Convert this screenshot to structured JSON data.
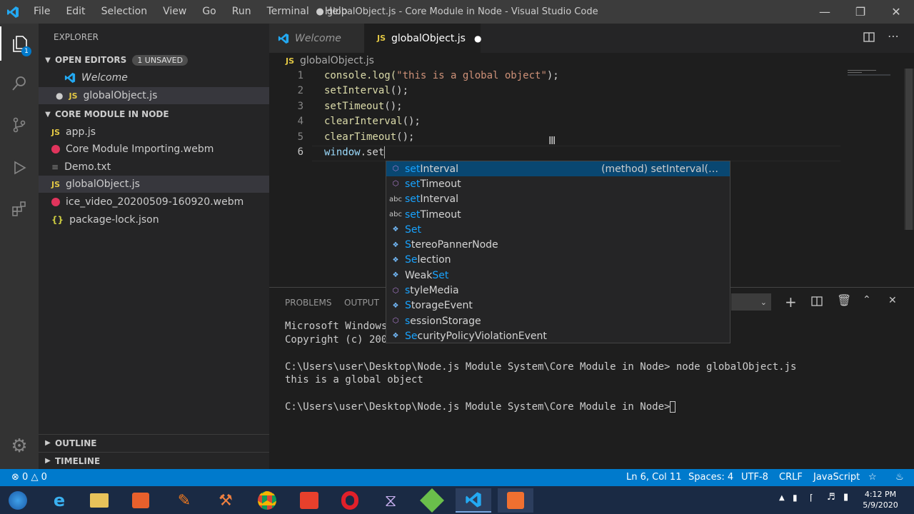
{
  "titlebar": {
    "menu": [
      "File",
      "Edit",
      "Selection",
      "View",
      "Go",
      "Run",
      "Terminal",
      "Help"
    ],
    "title": "● globalObject.js - Core Module in Node - Visual Studio Code"
  },
  "activity": {
    "explorer_badge": "1"
  },
  "sidebar": {
    "header": "EXPLORER",
    "open_editors": {
      "title": "OPEN EDITORS",
      "badge": "1 UNSAVED",
      "items": [
        {
          "label": "Welcome"
        },
        {
          "label": "globalObject.js",
          "icon": "JS"
        }
      ]
    },
    "folder": {
      "title": "CORE MODULE IN NODE",
      "items": [
        {
          "label": "app.js",
          "icon": "JS"
        },
        {
          "label": "Core Module Importing.webm"
        },
        {
          "label": "Demo.txt"
        },
        {
          "label": "globalObject.js",
          "icon": "JS"
        },
        {
          "label": "ice_video_20200509-160920.webm"
        },
        {
          "label": "package-lock.json",
          "icon": "{}"
        }
      ]
    },
    "outline": "OUTLINE",
    "timeline": "TIMELINE"
  },
  "tabs": [
    {
      "label": "Welcome"
    },
    {
      "label": "globalObject.js",
      "icon": "JS"
    }
  ],
  "breadcrumb": {
    "icon": "JS",
    "file": "globalObject.js"
  },
  "editor": {
    "line_numbers": [
      "1",
      "2",
      "3",
      "4",
      "5",
      "6"
    ],
    "lines": [
      {
        "fn": "console.log(",
        "str": "\"this is a global object\"",
        "rest": ");"
      },
      {
        "fn": "setInterval",
        "rest": "();"
      },
      {
        "fn": "setTimeout",
        "rest": "();"
      },
      {
        "fn": "clearInterval",
        "rest": "();"
      },
      {
        "fn": "clearTimeout",
        "rest": "();"
      },
      {
        "var": "window",
        "rest": ".set"
      }
    ]
  },
  "suggest": {
    "detail": "(method) setInterval(…",
    "items": [
      {
        "icon": "method",
        "pre": "",
        "match": "set",
        "post": "Interval"
      },
      {
        "icon": "method",
        "pre": "",
        "match": "set",
        "post": "Timeout"
      },
      {
        "icon": "abc",
        "pre": "",
        "match": "set",
        "post": "Interval"
      },
      {
        "icon": "abc",
        "pre": "",
        "match": "set",
        "post": "Timeout"
      },
      {
        "icon": "field",
        "pre": "",
        "match": "Set",
        "post": ""
      },
      {
        "icon": "field",
        "pre": "",
        "match": "S",
        "post": "tereoPannerNode"
      },
      {
        "icon": "field",
        "pre": "",
        "match": "Se",
        "post": "lection"
      },
      {
        "icon": "field",
        "pre": "Weak",
        "match": "Set",
        "post": ""
      },
      {
        "icon": "method",
        "pre": "",
        "match": "s",
        "post": "tyleMedia"
      },
      {
        "icon": "field",
        "pre": "",
        "match": "S",
        "post": "torageEvent"
      },
      {
        "icon": "method",
        "pre": "",
        "match": "s",
        "post": "essionStorage"
      },
      {
        "icon": "field",
        "pre": "",
        "match": "Se",
        "post": "curityPolicyViolationEvent"
      }
    ]
  },
  "panel": {
    "tabs": [
      "PROBLEMS",
      "OUTPUT"
    ],
    "terminal": [
      "Microsoft Windows",
      "Copyright (c) 200",
      "",
      "C:\\Users\\user\\Desktop\\Node.js Module System\\Core Module in Node> node globalObject.js",
      "this is a global object",
      "",
      "C:\\Users\\user\\Desktop\\Node.js Module System\\Core Module in Node>"
    ]
  },
  "status": {
    "errors": "0",
    "warnings": "0",
    "position": "Ln 6, Col 11",
    "spaces": "Spaces: 4",
    "encoding": "UTF-8",
    "eol": "CRLF",
    "language": "JavaScript"
  },
  "taskbar": {
    "time": "4:12 PM",
    "date": "5/9/2020"
  },
  "colors": {
    "accent": "#007acc",
    "titlebar": "#3c3c3c",
    "sidebar": "#252526",
    "editor": "#1e1e1e",
    "match": "#18a3ff"
  }
}
